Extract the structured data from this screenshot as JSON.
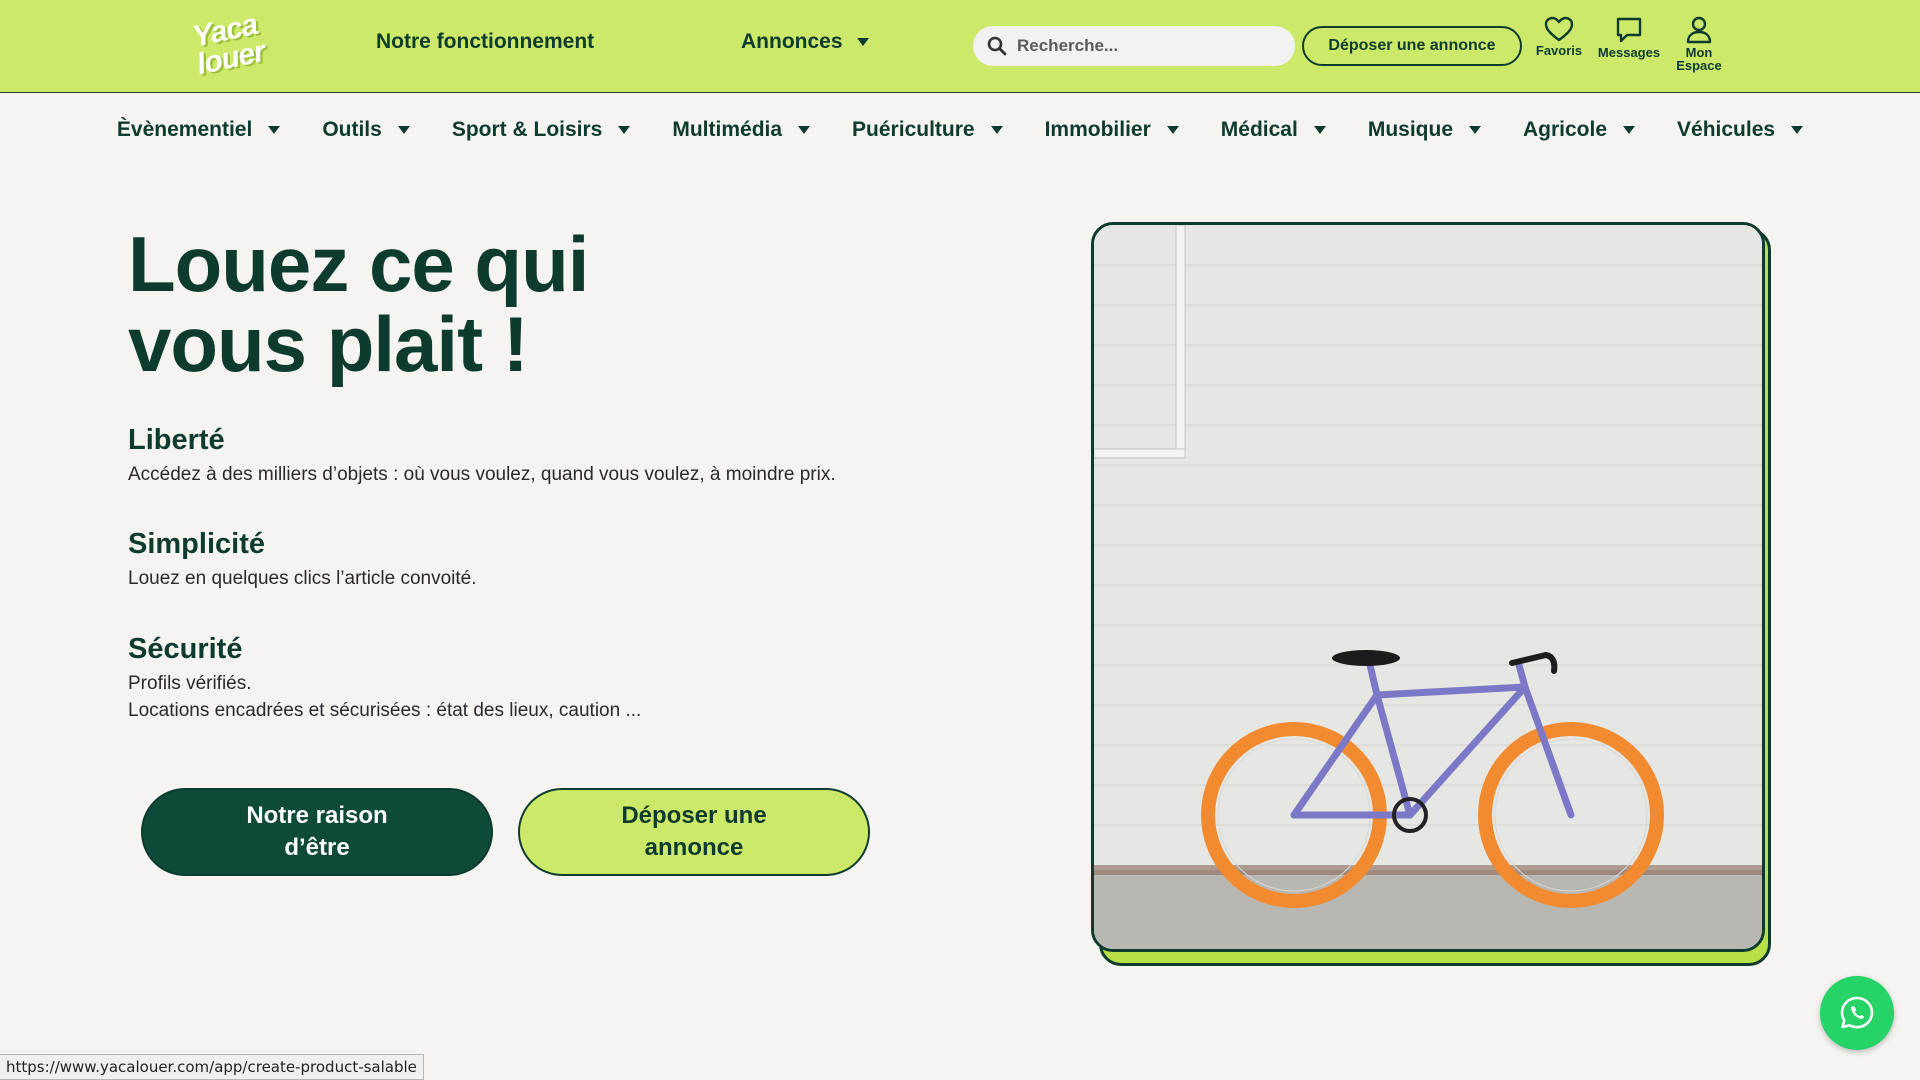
{
  "header": {
    "logo_line1": "Yaca",
    "logo_line2": "louer",
    "nav_how": "Notre fonctionnement",
    "nav_listings": "Annonces",
    "search_placeholder": "Recherche...",
    "post_button": "Déposer une annonce",
    "favorites": "Favoris",
    "messages": "Messages",
    "account_line1": "Mon",
    "account_line2": "Espace"
  },
  "categories": [
    "Èvènementiel",
    "Outils",
    "Sport & Loisirs",
    "Multimédia",
    "Puériculture",
    "Immobilier",
    "Médical",
    "Musique",
    "Agricole",
    "Véhicules"
  ],
  "hero": {
    "title_line1": "Louez ce qui",
    "title_line2": "vous plait !",
    "features": [
      {
        "title": "Liberté",
        "lines": [
          "Accédez à des milliers d’objets : où vous voulez, quand vous voulez, à moindre prix."
        ]
      },
      {
        "title": "Simplicité",
        "lines": [
          "Louez en quelques clics l’article convoité."
        ]
      },
      {
        "title": "Sécurité",
        "lines": [
          "Profils vérifiés.",
          "Locations encadrées et sécurisées : état des lieux, caution ..."
        ]
      }
    ],
    "cta_primary": "Notre raison d’être",
    "cta_secondary": "Déposer une annonce"
  },
  "status_url": "https://www.yacalouer.com/app/create-product-salable",
  "colors": {
    "brand_lime": "#cde96a",
    "brand_green": "#0d3b2e",
    "whatsapp": "#25d366"
  }
}
